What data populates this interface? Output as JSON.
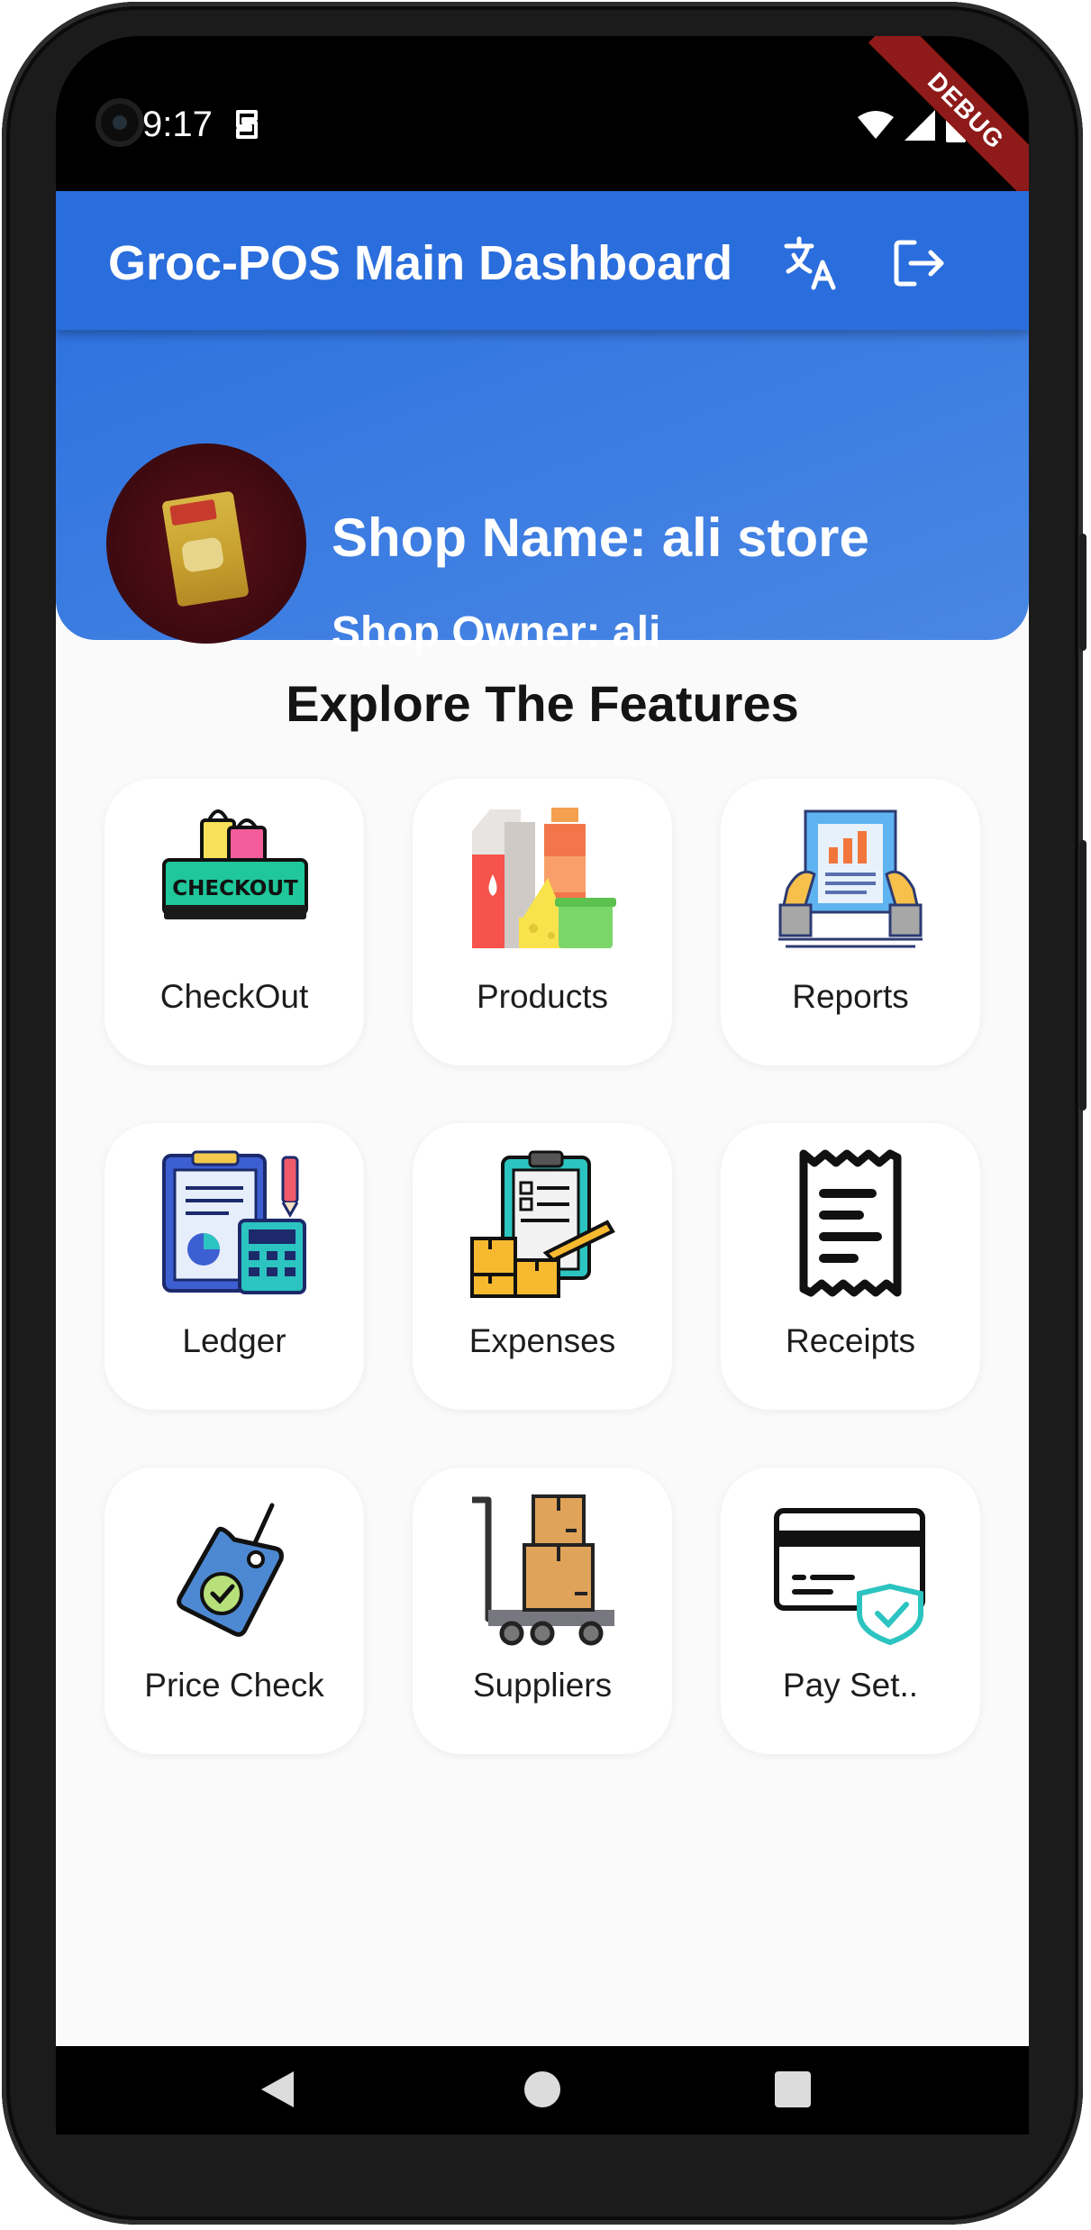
{
  "status_bar": {
    "time": "9:17",
    "debug_banner": "DEBUG"
  },
  "app_bar": {
    "title": "Groc-POS Main Dashboard",
    "translate_icon": "translate-icon",
    "logout_icon": "logout-icon",
    "color": "#2a6ddc"
  },
  "header": {
    "shop_name": "Shop Name: ali store",
    "shop_owner": "Shop Owner: ali"
  },
  "features": {
    "title": "Explore The Features",
    "items": [
      {
        "label": "CheckOut",
        "icon": "checkout-icon"
      },
      {
        "label": "Products",
        "icon": "products-icon"
      },
      {
        "label": "Reports",
        "icon": "reports-icon"
      },
      {
        "label": "Ledger",
        "icon": "ledger-icon"
      },
      {
        "label": "Expenses",
        "icon": "expenses-icon"
      },
      {
        "label": "Receipts",
        "icon": "receipt-icon"
      },
      {
        "label": "Price Check",
        "icon": "price-tag-icon"
      },
      {
        "label": "Suppliers",
        "icon": "supplier-cart-icon"
      },
      {
        "label": "Pay Set..",
        "icon": "payment-card-icon"
      }
    ]
  },
  "checkout_icon_text": "CHECKOUT"
}
